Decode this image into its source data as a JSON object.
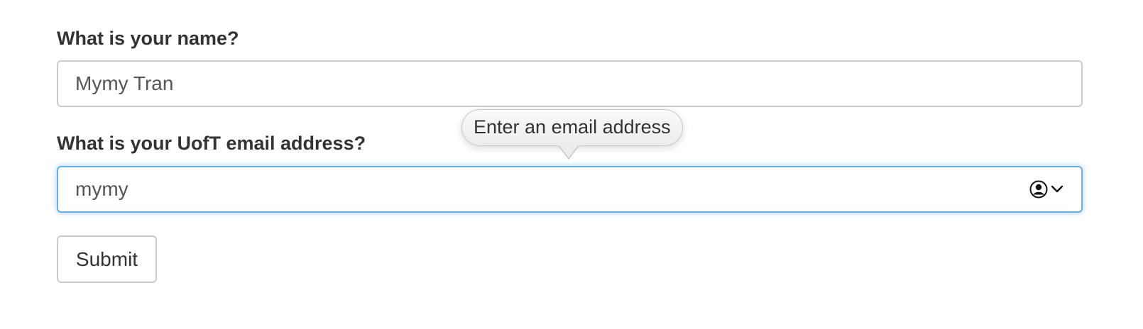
{
  "form": {
    "name_field": {
      "label": "What is your name?",
      "value": "Mymy Tran"
    },
    "email_field": {
      "label": "What is your UofT email address?",
      "value": "mymy",
      "focused": true,
      "autofill_icon": "person-circle-icon",
      "dropdown_icon": "chevron-down-icon"
    },
    "validation_tooltip": "Enter an email address",
    "submit_label": "Submit"
  },
  "colors": {
    "text": "#333333",
    "input_text": "#555555",
    "border": "#cccccc",
    "focus_border": "#66afe9"
  }
}
